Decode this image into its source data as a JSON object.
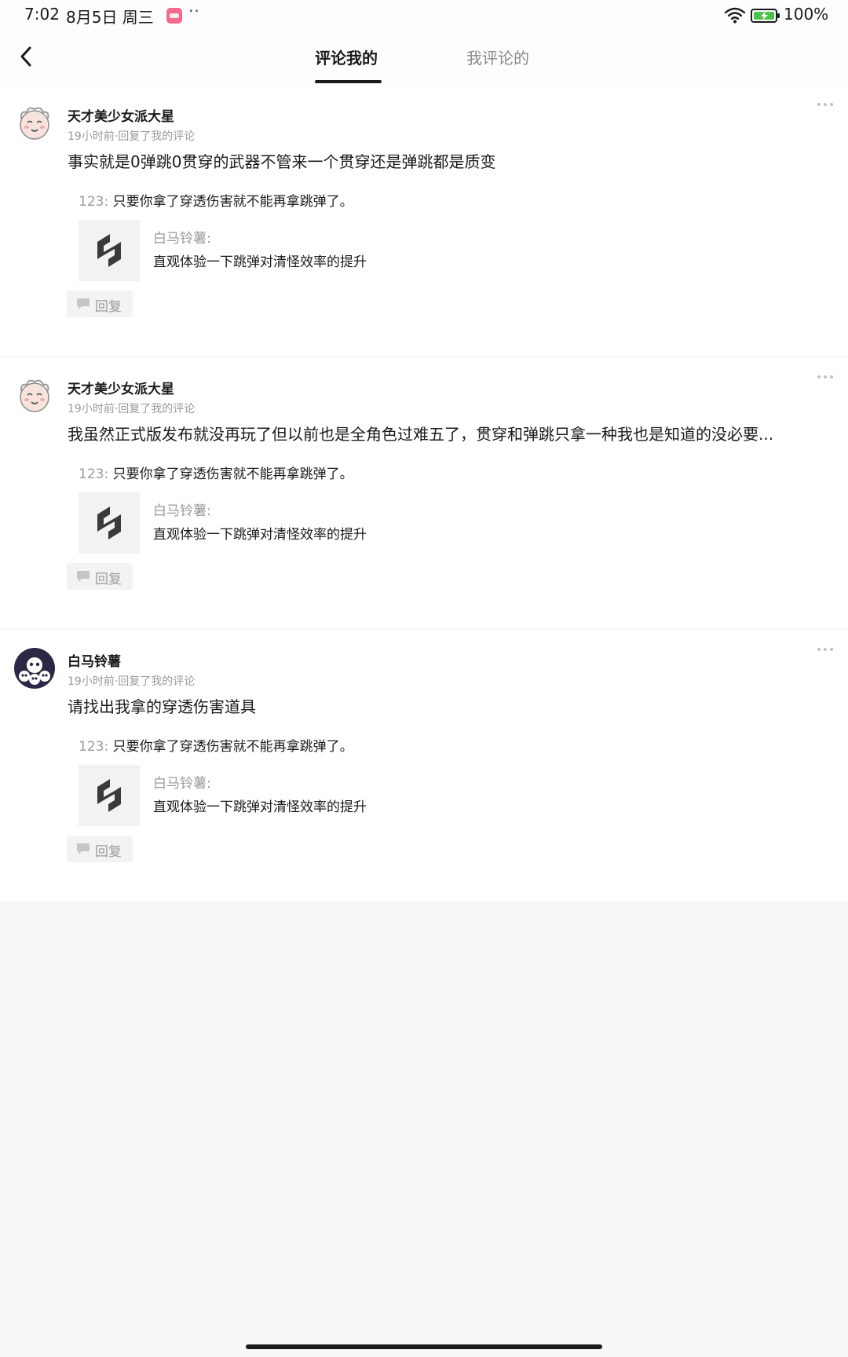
{
  "status_bar": {
    "time": "7:02",
    "date": "8月5日 周三",
    "more": "··",
    "battery": "100%"
  },
  "header": {
    "tabs": [
      "评论我的",
      "我评论的"
    ],
    "active_tab": 0
  },
  "comments": [
    {
      "author": "天才美少女派大星",
      "meta": "19小时前·回复了我的评论",
      "text": "事实就是0弹跳0贯穿的武器不管来一个贯穿还是弹跳都是质变",
      "quote_user": "123:",
      "quote_text": "只要你拿了穿透伤害就不能再拿跳弹了。",
      "ref_author": "白马铃薯:",
      "ref_text": "直观体验一下跳弹对清怪效率的提升",
      "reply_label": "回复"
    },
    {
      "author": "天才美少女派大星",
      "meta": "19小时前·回复了我的评论",
      "text": "我虽然正式版发布就没再玩了但以前也是全角色过难五了，贯穿和弹跳只拿一种我也是知道的没必要...",
      "quote_user": "123:",
      "quote_text": "只要你拿了穿透伤害就不能再拿跳弹了。",
      "ref_author": "白马铃薯:",
      "ref_text": "直观体验一下跳弹对清怪效率的提升",
      "reply_label": "回复"
    },
    {
      "author": "白马铃薯",
      "meta": "19小时前·回复了我的评论",
      "text": "请找出我拿的穿透伤害道具",
      "quote_user": "123:",
      "quote_text": "只要你拿了穿透伤害就不能再拿跳弹了。",
      "ref_author": "白马铃薯:",
      "ref_text": "直观体验一下跳弹对清怪效率的提升",
      "reply_label": "回复"
    }
  ],
  "colors": {
    "page_background": "#f7f8fa",
    "card_background": "#ffffff",
    "primary_text": "#1a1a1a",
    "secondary_text": "#9a9a9a",
    "battery_green": "#4cc24c"
  },
  "icons": {
    "back": "back-arrow-icon",
    "more": "more-dots-icon",
    "reply": "speech-bubble-icon",
    "wifi": "wifi-icon",
    "battery": "battery-charging-icon",
    "ref_logo": "app-logo-icon"
  }
}
